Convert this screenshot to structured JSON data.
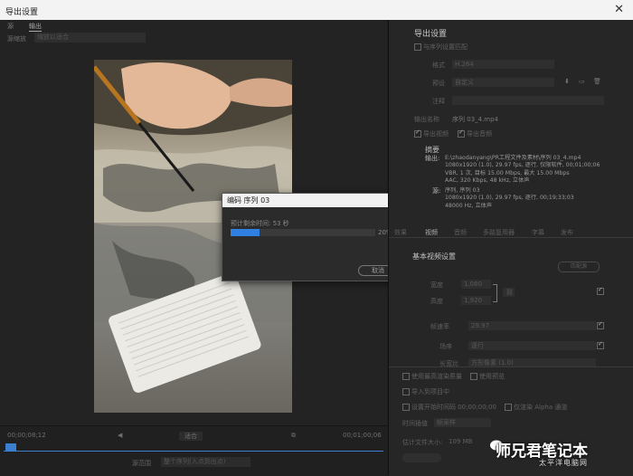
{
  "window": {
    "title": "导出设置",
    "close": "✕"
  },
  "left": {
    "tabs": [
      "源",
      "输出"
    ],
    "source_scaling_label": "源缩放",
    "source_scaling_value": "缩放以适合",
    "timecode_start": "00;00;08;12",
    "timecode_end": "00;01;00;06",
    "fit_label": "适合",
    "source_range_label": "源范围",
    "source_range_value": "整个序列(入点到出点)"
  },
  "dialog": {
    "title": "编码 序列 03",
    "close": "✕",
    "remaining_label": "预计剩余时间: 53 秒",
    "progress": 0.2,
    "progress_text": "20%",
    "cancel": "取消"
  },
  "right": {
    "title": "导出设置",
    "match_seq_label": "与序列设置匹配",
    "format_label": "格式",
    "format_value": "H.264",
    "preset_label": "预设",
    "preset_value": "自定义",
    "comments_label": "注释",
    "output_name_label": "输出名称",
    "output_name_value": "序列 03_4.mp4",
    "export_video_label": "导出视频",
    "export_audio_label": "导出音频",
    "summary_title": "摘要",
    "output_key": "输出:",
    "output_lines": [
      "E:\\zhaodanyang\\PR工程文件及素材\\序列 03_4.mp4",
      "1080x1920 (1.0), 29.97 fps, 逐行, 仅限软件, 00;01;00;06",
      "VBR, 1 次, 目标 15.00 Mbps, 最大 15.00 Mbps",
      "AAC, 320 Kbps, 48 kHz, 立体声"
    ],
    "source_key": "源:",
    "source_lines": [
      "序列, 序列 03",
      "1080x1920 (1.0), 29.97 fps, 逐行, 00;19;33;03",
      "48000 Hz, 立体声"
    ],
    "tabs": [
      "效果",
      "视频",
      "音频",
      "多路复用器",
      "字幕",
      "发布"
    ],
    "basic_video_title": "基本视频设置",
    "match_source": "匹配源",
    "width_label": "宽度",
    "width_value": "1,080",
    "height_label": "高度",
    "height_value": "1,920",
    "framerate_label": "帧速率",
    "framerate_value": "29.97",
    "field_order_label": "场序",
    "field_order_value": "逐行",
    "aspect_label": "长宽比",
    "aspect_value": "方形像素 (1.0)",
    "max_render_label": "使用最高渲染质量",
    "use_preview_label": "使用预览",
    "import_project_label": "导入到项目中",
    "start_tc_label": "设置开始时间码 00;00;00;00",
    "render_alpha_label": "仅渲染 Alpha 通道",
    "time_interp_label": "时间插值",
    "time_interp_value": "帧采样",
    "file_size_label": "估计文件大小:",
    "file_size_value": "109 MB"
  },
  "watermark": {
    "main": "师兄君笔记本",
    "sub": "太平洋电脑网"
  }
}
